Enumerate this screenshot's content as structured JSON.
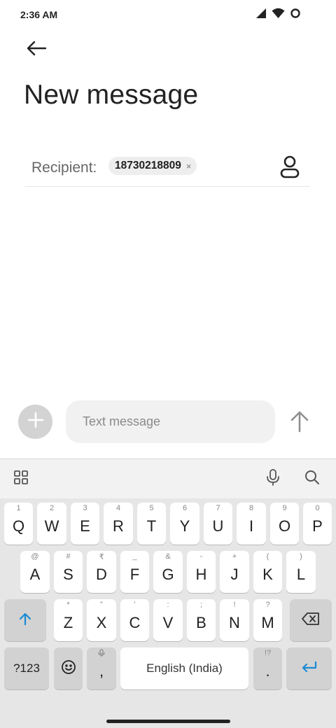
{
  "status_bar": {
    "time": "2:36 AM",
    "icons": [
      "cellular-signal-icon",
      "wifi-icon",
      "battery-circle-icon"
    ]
  },
  "header": {
    "back_icon": "back-arrow-icon",
    "title": "New message"
  },
  "recipient": {
    "label": "Recipient:",
    "chips": [
      {
        "text": "18730218809",
        "remove_glyph": "×"
      }
    ],
    "contact_icon": "contact-person-icon"
  },
  "compose": {
    "attach_icon": "plus-icon",
    "placeholder": "Text message",
    "send_icon": "send-arrow-up-icon"
  },
  "keyboard": {
    "toolbar": [
      "grid-apps-icon",
      "microphone-icon",
      "search-icon"
    ],
    "row1": [
      {
        "main": "Q",
        "hint": "1"
      },
      {
        "main": "W",
        "hint": "2"
      },
      {
        "main": "E",
        "hint": "3"
      },
      {
        "main": "R",
        "hint": "4"
      },
      {
        "main": "T",
        "hint": "5"
      },
      {
        "main": "Y",
        "hint": "6"
      },
      {
        "main": "U",
        "hint": "7"
      },
      {
        "main": "I",
        "hint": "8"
      },
      {
        "main": "O",
        "hint": "9"
      },
      {
        "main": "P",
        "hint": "0"
      }
    ],
    "row2": [
      {
        "main": "A",
        "hint": "@"
      },
      {
        "main": "S",
        "hint": "#"
      },
      {
        "main": "D",
        "hint": "₹"
      },
      {
        "main": "F",
        "hint": "_"
      },
      {
        "main": "G",
        "hint": "&"
      },
      {
        "main": "H",
        "hint": "-"
      },
      {
        "main": "J",
        "hint": "+"
      },
      {
        "main": "K",
        "hint": "("
      },
      {
        "main": "L",
        "hint": ")"
      }
    ],
    "row3": [
      {
        "main": "Z",
        "hint": "*"
      },
      {
        "main": "X",
        "hint": "\""
      },
      {
        "main": "C",
        "hint": "'"
      },
      {
        "main": "V",
        "hint": ":"
      },
      {
        "main": "B",
        "hint": ";"
      },
      {
        "main": "N",
        "hint": "!"
      },
      {
        "main": "M",
        "hint": "?"
      }
    ],
    "shift_icon": "shift-arrow-icon",
    "backspace_icon": "backspace-icon",
    "symbols_label": "?123",
    "emoji_icon": "emoji-icon",
    "comma": {
      "main": ",",
      "hint_icon": "microphone-icon"
    },
    "space_label": "English (India)",
    "period": {
      "main": ".",
      "hint": "!?"
    },
    "enter_icon": "enter-arrow-icon",
    "accent_color": "#1a8ad4"
  }
}
